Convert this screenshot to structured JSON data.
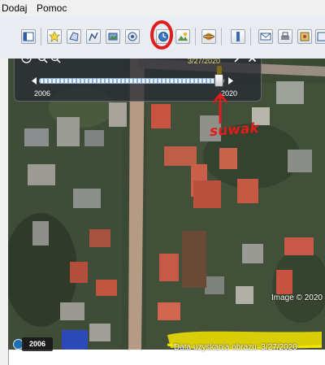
{
  "menu": {
    "items": [
      "Dodaj",
      "Pomoc"
    ]
  },
  "toolbar": {
    "icons": [
      "sidebar-icon",
      "placemark-icon",
      "polygon-icon",
      "path-icon",
      "image-overlay-icon",
      "record-tour-icon",
      "historical-imagery-icon",
      "sunlight-icon",
      "planets-icon",
      "ruler-icon",
      "email-icon",
      "print-icon",
      "save-image-icon",
      "maps-icon"
    ]
  },
  "imagery_slider": {
    "start_year": "2006",
    "end_year": "2020",
    "current_date": "3/27/2020",
    "position": 0.95
  },
  "map": {
    "date_chip": "2006",
    "copyright": "Image © 2020",
    "acquisition_date": "Data uzyskania obrazu: 3/27/2020"
  },
  "annotations": {
    "slider_label": "suwak",
    "color": "#e21b1b",
    "highlight_color": "#f5e400"
  }
}
